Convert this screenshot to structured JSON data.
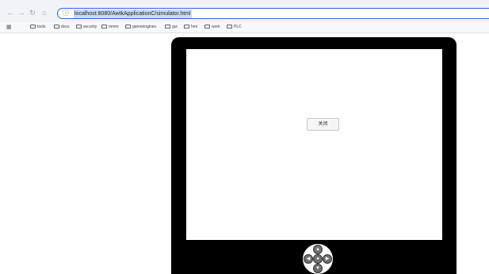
{
  "browser": {
    "url": "localhost:8080/AwtkApplicationC/simulator.html",
    "bookmarks": [
      {
        "label": "tools"
      },
      {
        "label": "docs"
      },
      {
        "label": "security"
      },
      {
        "label": "mmm"
      },
      {
        "label": "gameengines"
      },
      {
        "label": "gui"
      },
      {
        "label": "hmi"
      },
      {
        "label": "work"
      },
      {
        "label": "PLC"
      }
    ]
  },
  "simulator": {
    "close_label": "关闭"
  }
}
